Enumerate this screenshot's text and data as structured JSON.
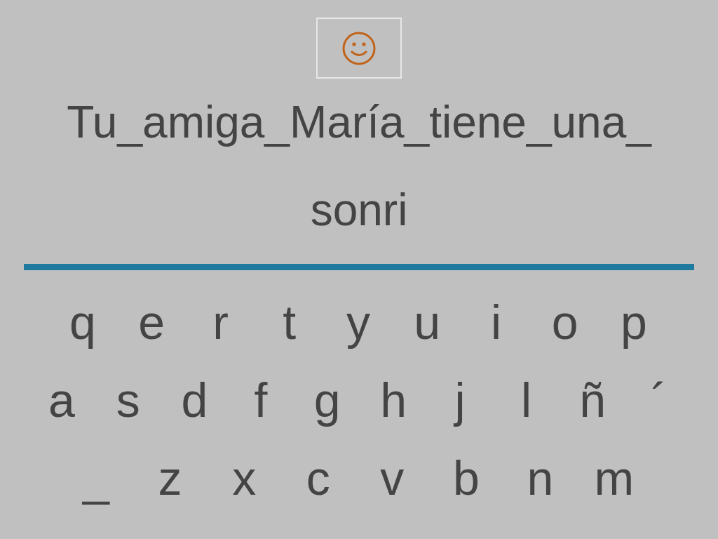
{
  "phrase_lines": [
    "Tu_amiga_María_tiene_una_",
    "sonri"
  ],
  "keyboard_rows": [
    [
      "q",
      "e",
      "r",
      "t",
      "y",
      "u",
      "i",
      "o",
      "p"
    ],
    [
      "a",
      "s",
      "d",
      "f",
      "g",
      "h",
      "j",
      "l",
      "ñ",
      "´"
    ],
    [
      "_",
      "z",
      "x",
      "c",
      "v",
      "b",
      "n",
      "m"
    ]
  ]
}
